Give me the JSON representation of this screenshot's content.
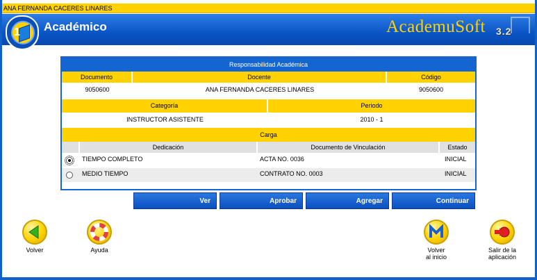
{
  "user_name": "ANA FERNANDA CACERES LINARES",
  "header": {
    "module_title": "Académico",
    "brand_name": "AcademuSoft",
    "brand_version": "3.2"
  },
  "panel": {
    "title": "Responsabilidad Académica",
    "col_documento": "Documento",
    "col_docente": "Docente",
    "col_codigo": "Código",
    "documento": "9050600",
    "docente": "ANA FERNANDA CACERES LINARES",
    "codigo": "9050600",
    "col_categoria": "Categoría",
    "col_periodo": "Periodo",
    "categoria": "INSTRUCTOR ASISTENTE",
    "periodo": "2010 - 1",
    "carga_title": "Carga",
    "carga_headers": {
      "dedicacion": "Dedicación",
      "documento_vinculacion": "Documento de Vinculación",
      "estado": "Estado"
    },
    "carga_rows": [
      {
        "dedicacion": "TIEMPO COMPLETO",
        "documento": "ACTA NO. 0036",
        "estado": "INICIAL",
        "selected": true
      },
      {
        "dedicacion": "MEDIO TIEMPO",
        "documento": "CONTRATO NO. 0003",
        "estado": "INICIAL",
        "selected": false
      }
    ]
  },
  "actions": {
    "ver": "Ver",
    "aprobar": "Aprobar",
    "agregar": "Agregar",
    "continuar": "Continuar"
  },
  "nav": {
    "volver": "Volver",
    "ayuda": "Ayuda",
    "volver_inicio_1": "Volver",
    "volver_inicio_2": "al inicio",
    "salir_1": "Salir de la",
    "salir_2": "aplicación"
  },
  "colors": {
    "primary_blue": "#1565d0",
    "accent_yellow": "#ffd200"
  },
  "icons": {
    "logo": "academusoft-book-logo-icon",
    "volver": "green-back-arrow-icon",
    "ayuda": "lifebuoy-icon",
    "volver_inicio": "home-m-icon",
    "salir": "exit-door-icon"
  }
}
